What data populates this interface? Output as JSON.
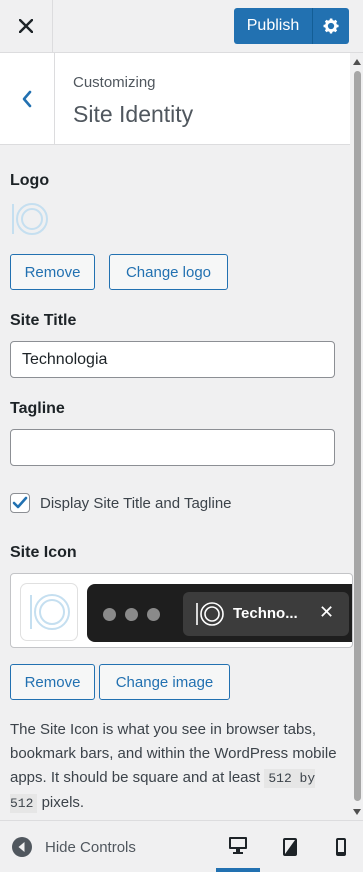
{
  "header": {
    "close_icon": "close-icon",
    "publish_label": "Publish",
    "settings_icon": "gear-icon",
    "accent_color": "#2271b1"
  },
  "section": {
    "breadcrumb": "Customizing",
    "title": "Site Identity"
  },
  "logo": {
    "label": "Logo",
    "remove_label": "Remove",
    "change_label": "Change logo"
  },
  "site_title": {
    "label": "Site Title",
    "value": "Technologia"
  },
  "tagline": {
    "label": "Tagline",
    "value": ""
  },
  "display_title": {
    "label": "Display Site Title and Tagline",
    "checked": true
  },
  "site_icon": {
    "label": "Site Icon",
    "tab_title": "Techno...",
    "tab_close": "✕",
    "remove_label": "Remove",
    "change_label": "Change image"
  },
  "description": {
    "text_before": "The Site Icon is what you see in browser tabs, bookmark bars, and within the WordPress mobile apps. It should be square and at least ",
    "code": "512 by 512",
    "text_after": " pixels."
  },
  "footer": {
    "hide_controls_label": "Hide Controls",
    "active_device": "desktop"
  }
}
